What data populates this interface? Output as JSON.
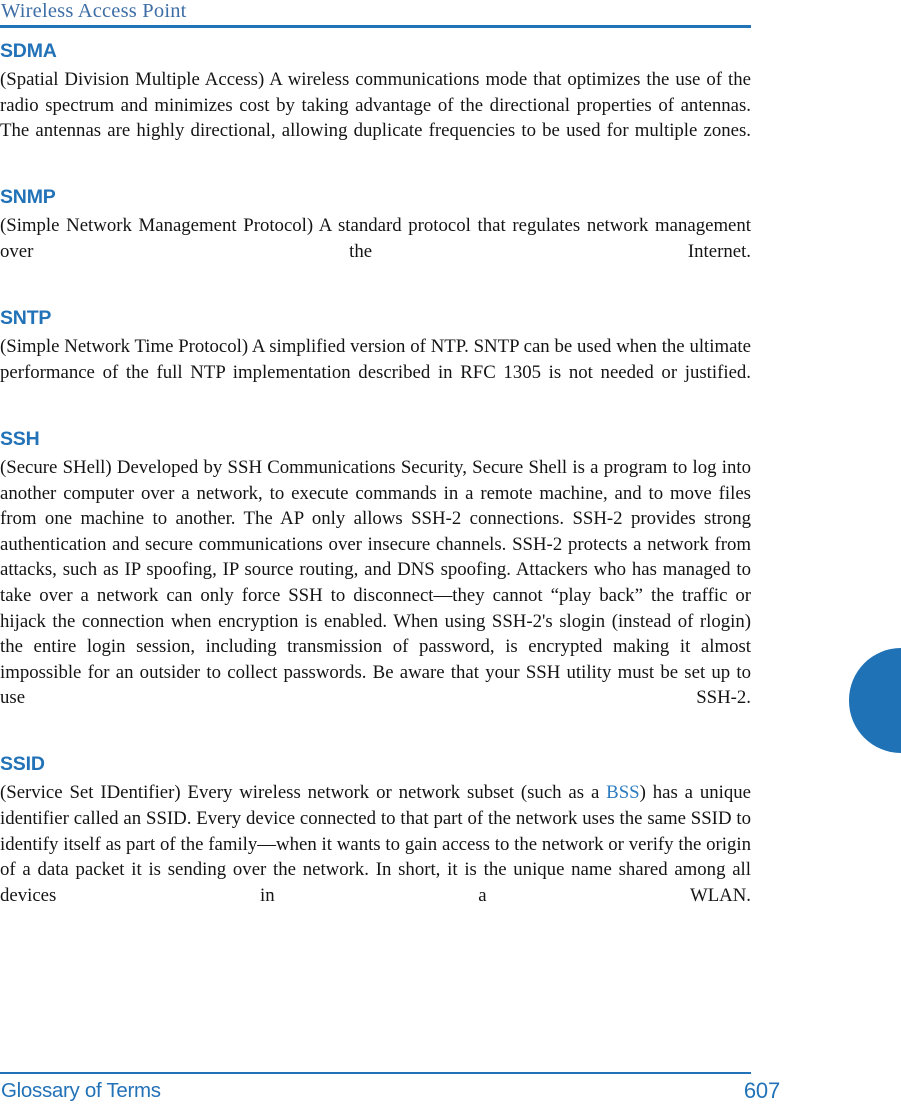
{
  "header": {
    "title": "Wireless Access Point",
    "rule_color": "#2272b8"
  },
  "theme": {
    "heading_blue": "#2272b8",
    "header_title_blue": "#3d6ea6",
    "link_blue": "#2e7cc0",
    "tab_blue": "#1f72b5",
    "body_text": "#141414",
    "page_background": "#ffffff"
  },
  "entries": [
    {
      "term": "SDMA",
      "definition": "(Spatial Division Multiple Access) A wireless communications mode that optimizes the use of the radio spectrum and minimizes cost by taking advantage of the directional properties of antennas. The antennas are highly directional, allowing duplicate frequencies to be used for multiple zones."
    },
    {
      "term": "SNMP",
      "definition": "(Simple Network Management Protocol) A standard protocol that regulates network management over the Internet."
    },
    {
      "term": "SNTP",
      "definition": "(Simple Network Time Protocol) A simplified version of NTP. SNTP can be used when the ultimate performance of the full NTP implementation described in RFC 1305 is not needed or justified."
    },
    {
      "term": "SSH",
      "definition": "(Secure SHell) Developed by SSH Communications Security, Secure Shell is a program to log into another computer over a network, to execute commands in a remote machine, and to move files from one machine to another. The AP only allows SSH-2 connections. SSH-2 provides strong authentication and secure communications over insecure channels. SSH-2 protects a network from attacks, such as IP spoofing, IP source routing, and DNS spoofing. Attackers who has managed to take over a network can only force SSH to disconnect—they cannot “play back” the traffic or hijack the connection when encryption is enabled. When using SSH-2's slogin (instead of rlogin) the entire login session, including transmission of password, is encrypted making it almost impossible for an outsider to collect passwords. Be aware that your SSH utility must be set up to use SSH-2."
    },
    {
      "term": "SSID",
      "definition_before_link": "(Service Set IDentifier) Every wireless network or network subset (such as a ",
      "link_text": "BSS",
      "definition_after_link": ") has a unique identifier called an SSID. Every device connected to that part of the network uses the same SSID to identify itself as part of the family—when it wants to gain access to the network or verify the origin of a data packet it is sending over the network. In short, it is the unique name shared among all devices in a WLAN."
    }
  ],
  "thumb_tab": {
    "label": ""
  },
  "footer": {
    "section_label": "Glossary of Terms",
    "page_number": "607"
  }
}
